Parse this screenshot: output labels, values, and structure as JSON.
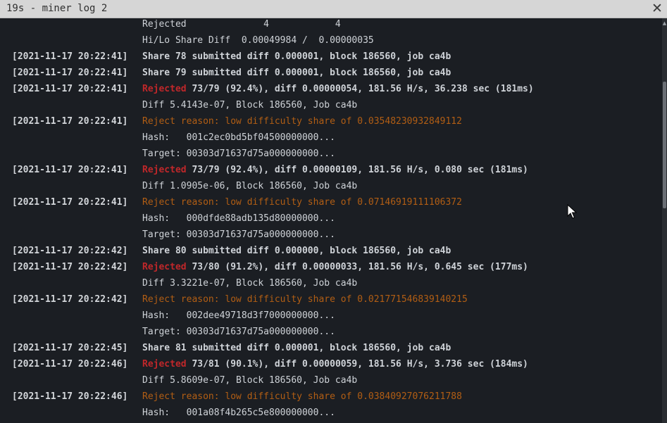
{
  "window": {
    "title": "19s - miner log 2",
    "close_glyph": "✕"
  },
  "lines": [
    {
      "ts": "",
      "kind": "detail",
      "text": "Rejected              4            4"
    },
    {
      "ts": "",
      "kind": "detail",
      "text": "Hi/Lo Share Diff  0.00049984 /  0.00000035"
    },
    {
      "ts": "[2021-11-17 20:22:41]",
      "kind": "share",
      "text": "Share 78 submitted diff 0.000001, block 186560, job ca4b"
    },
    {
      "ts": "[2021-11-17 20:22:41]",
      "kind": "share",
      "text": "Share 79 submitted diff 0.000001, block 186560, job ca4b"
    },
    {
      "ts": "[2021-11-17 20:22:41]",
      "kind": "rejected",
      "label": "Rejected",
      "text": " 73/79 (92.4%), diff 0.00000054, 181.56 H/s, 36.238 sec (181ms)"
    },
    {
      "ts": "",
      "kind": "detail",
      "text": "Diff 5.4143e-07, Block 186560, Job ca4b"
    },
    {
      "ts": "[2021-11-17 20:22:41]",
      "kind": "reason",
      "text": "Reject reason: low difficulty share of 0.03548230932849112"
    },
    {
      "ts": "",
      "kind": "detail",
      "text": "Hash:   001c2ec0bd5bf04500000000..."
    },
    {
      "ts": "",
      "kind": "detail",
      "text": "Target: 00303d71637d75a000000000..."
    },
    {
      "ts": "[2021-11-17 20:22:41]",
      "kind": "rejected",
      "label": "Rejected",
      "text": " 73/79 (92.4%), diff 0.00000109, 181.56 H/s, 0.080 sec (181ms)"
    },
    {
      "ts": "",
      "kind": "detail",
      "text": "Diff 1.0905e-06, Block 186560, Job ca4b"
    },
    {
      "ts": "[2021-11-17 20:22:41]",
      "kind": "reason",
      "text": "Reject reason: low difficulty share of 0.07146919111106372"
    },
    {
      "ts": "",
      "kind": "detail",
      "text": "Hash:   000dfde88adb135d80000000..."
    },
    {
      "ts": "",
      "kind": "detail",
      "text": "Target: 00303d71637d75a000000000..."
    },
    {
      "ts": "[2021-11-17 20:22:42]",
      "kind": "share",
      "text": "Share 80 submitted diff 0.000000, block 186560, job ca4b"
    },
    {
      "ts": "[2021-11-17 20:22:42]",
      "kind": "rejected",
      "label": "Rejected",
      "text": " 73/80 (91.2%), diff 0.00000033, 181.56 H/s, 0.645 sec (177ms)"
    },
    {
      "ts": "",
      "kind": "detail",
      "text": "Diff 3.3221e-07, Block 186560, Job ca4b"
    },
    {
      "ts": "[2021-11-17 20:22:42]",
      "kind": "reason",
      "text": "Reject reason: low difficulty share of 0.021771546839140215"
    },
    {
      "ts": "",
      "kind": "detail",
      "text": "Hash:   002dee49718d3f7000000000..."
    },
    {
      "ts": "",
      "kind": "detail",
      "text": "Target: 00303d71637d75a000000000..."
    },
    {
      "ts": "[2021-11-17 20:22:45]",
      "kind": "share",
      "text": "Share 81 submitted diff 0.000001, block 186560, job ca4b"
    },
    {
      "ts": "[2021-11-17 20:22:46]",
      "kind": "rejected",
      "label": "Rejected",
      "text": " 73/81 (90.1%), diff 0.00000059, 181.56 H/s, 3.736 sec (184ms)"
    },
    {
      "ts": "",
      "kind": "detail",
      "text": "Diff 5.8609e-07, Block 186560, Job ca4b"
    },
    {
      "ts": "[2021-11-17 20:22:46]",
      "kind": "reason",
      "text": "Reject reason: low difficulty share of 0.03840927076211788"
    },
    {
      "ts": "",
      "kind": "detail",
      "text": "Hash:   001a08f4b265c5e800000000..."
    }
  ],
  "colors": {
    "background": "#1b1e23",
    "text": "#cfd3d8",
    "rejected": "#c0272a",
    "reason": "#b25e14",
    "titlebar": "#d6d6d6"
  },
  "icons": {
    "close": "close-icon",
    "cursor": "mouse-pointer-icon"
  }
}
